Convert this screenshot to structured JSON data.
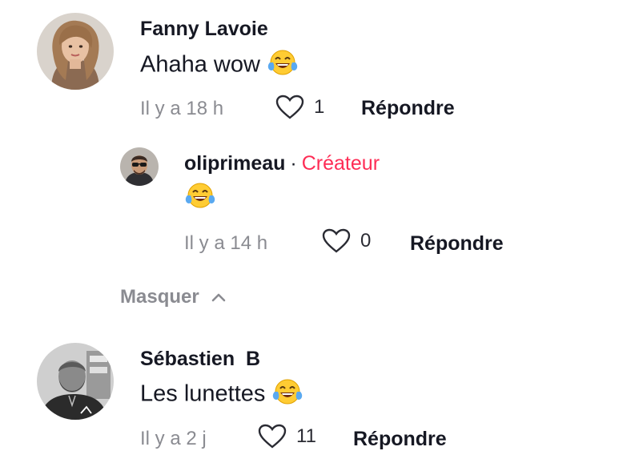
{
  "comments": [
    {
      "username": "Fanny Lavoie",
      "text": "Ahaha wow",
      "emoji": "face-with-tears-of-joy",
      "time": "Il y a 18 h",
      "likes": "1",
      "reply_label": "Répondre",
      "replies": [
        {
          "username": "oliprimeau",
          "separator": "·",
          "badge": "Créateur",
          "emoji": "face-with-tears-of-joy",
          "time": "Il y a 14 h",
          "likes": "0",
          "reply_label": "Répondre"
        }
      ],
      "hide_label": "Masquer"
    },
    {
      "username": "Sébastien  B",
      "text": "Les lunettes",
      "emoji": "face-with-tears-of-joy",
      "time": "Il y a 2 j",
      "likes": "11",
      "reply_label": "Répondre"
    }
  ],
  "colors": {
    "creator_badge": "#fe2c55",
    "meta_text": "#8a8b91",
    "primary_text": "#161823"
  }
}
